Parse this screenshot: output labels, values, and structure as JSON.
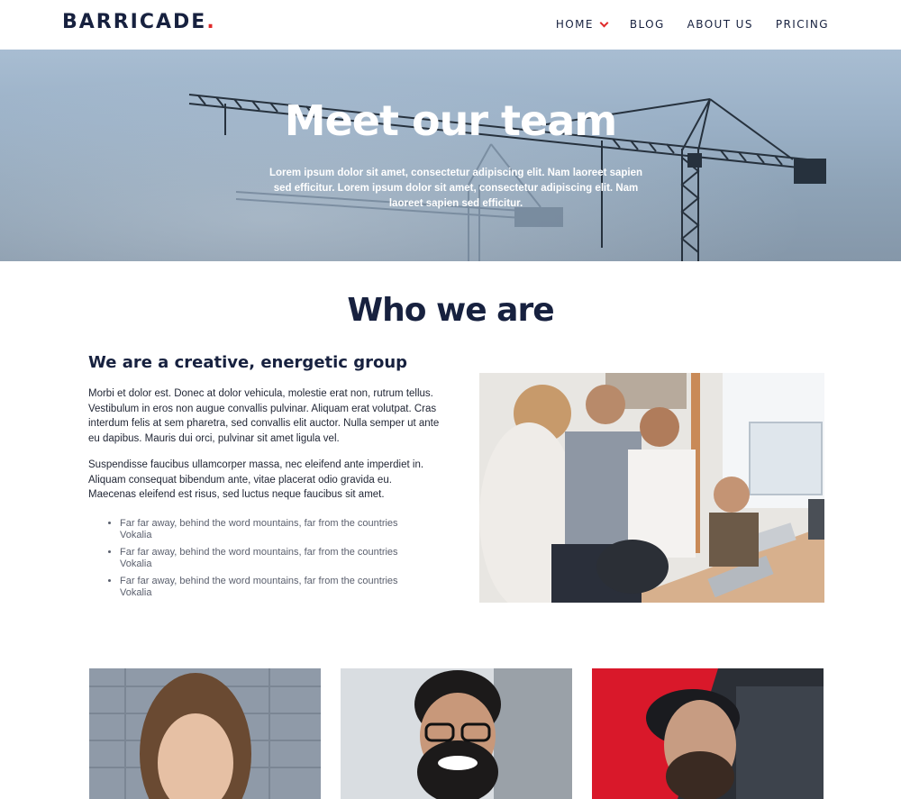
{
  "header": {
    "logo_text": "BARRICADE",
    "logo_dot": ".",
    "nav": [
      "HOME",
      "BLOG",
      "ABOUT US",
      "PRICING"
    ]
  },
  "hero": {
    "title": "Meet our team",
    "text": "Lorem ipsum dolor sit amet, consectetur adipiscing elit. Nam laoreet sapien sed efficitur. Lorem ipsum dolor sit amet, consectetur adipiscing elit. Nam laoreet sapien sed efficitur."
  },
  "about": {
    "title": "Who we are",
    "subtitle": "We are a creative, energetic group",
    "paragraph1": "Morbi et dolor est. Donec at dolor vehicula, molestie erat non, rutrum tellus. Vestibulum in eros non augue convallis pulvinar. Aliquam erat volutpat. Cras interdum felis at sem pharetra, sed convallis elit auctor. Nulla semper ut ante eu dapibus. Mauris dui orci, pulvinar sit amet ligula vel.",
    "paragraph2": "Suspendisse faucibus ullamcorper massa, nec eleifend ante imperdiet in. Aliquam consequat bibendum ante, vitae placerat odio gravida eu. Maecenas eleifend est risus, sed luctus neque faucibus sit amet.",
    "bullets": [
      "Far far away, behind the word mountains, far from the countries Vokalia",
      "Far far away, behind the word mountains, far from the countries Vokalia",
      "Far far away, behind the word mountains, far from the countries Vokalia"
    ]
  },
  "colors": {
    "brand_navy": "#17213f",
    "accent_red": "#e02a2a"
  },
  "icons": {
    "nav_dropdown": "chevron-down-icon"
  }
}
